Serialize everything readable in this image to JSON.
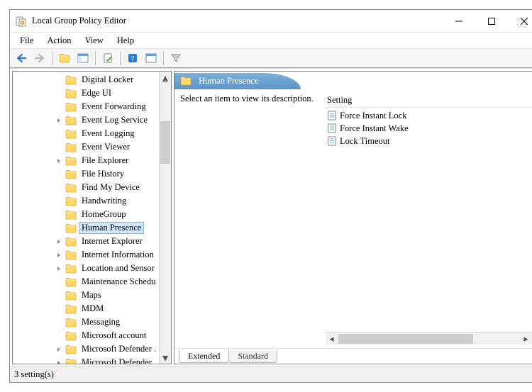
{
  "window": {
    "title": "Local Group Policy Editor"
  },
  "menu": {
    "file": "File",
    "action": "Action",
    "view": "View",
    "help": "Help"
  },
  "tree": {
    "items": [
      {
        "label": "Digital Locker",
        "expandable": false
      },
      {
        "label": "Edge UI",
        "expandable": false
      },
      {
        "label": "Event Forwarding",
        "expandable": false
      },
      {
        "label": "Event Log Service",
        "expandable": true
      },
      {
        "label": "Event Logging",
        "expandable": false
      },
      {
        "label": "Event Viewer",
        "expandable": false
      },
      {
        "label": "File Explorer",
        "expandable": true
      },
      {
        "label": "File History",
        "expandable": false
      },
      {
        "label": "Find My Device",
        "expandable": false
      },
      {
        "label": "Handwriting",
        "expandable": false
      },
      {
        "label": "HomeGroup",
        "expandable": false
      },
      {
        "label": "Human Presence",
        "expandable": false,
        "selected": true
      },
      {
        "label": "Internet Explorer",
        "expandable": true
      },
      {
        "label": "Internet Information",
        "expandable": true
      },
      {
        "label": "Location and Sensor",
        "expandable": true
      },
      {
        "label": "Maintenance Schedu",
        "expandable": false
      },
      {
        "label": "Maps",
        "expandable": false
      },
      {
        "label": "MDM",
        "expandable": false
      },
      {
        "label": "Messaging",
        "expandable": false
      },
      {
        "label": "Microsoft account",
        "expandable": false
      },
      {
        "label": "Microsoft Defender .",
        "expandable": true
      },
      {
        "label": "Microsoft Defender .",
        "expandable": true
      }
    ]
  },
  "detail": {
    "header": "Human Presence",
    "description": "Select an item to view its description.",
    "column": "Setting",
    "settings": [
      "Force Instant Lock",
      "Force Instant Wake",
      "Lock Timeout"
    ]
  },
  "tabs": {
    "extended": "Extended",
    "standard": "Standard"
  },
  "status": "3 setting(s)"
}
